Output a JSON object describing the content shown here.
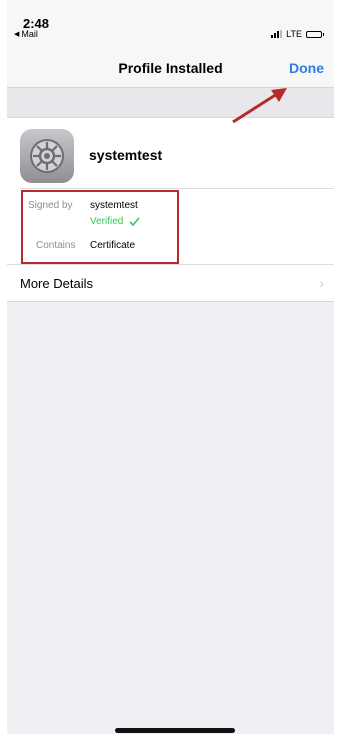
{
  "status_bar": {
    "time": "2:48",
    "back_app": "Mail",
    "network": "LTE"
  },
  "nav": {
    "title": "Profile Installed",
    "done_label": "Done"
  },
  "profile": {
    "name": "systemtest",
    "icon": "settings-gear-icon"
  },
  "details": {
    "signed_by_label": "Signed by",
    "signed_by_value": "systemtest",
    "verified_label": "Verified",
    "contains_label": "Contains",
    "contains_value": "Certificate"
  },
  "more_details": {
    "label": "More Details"
  },
  "colors": {
    "accent": "#2d7de9",
    "verified": "#34c759",
    "annotation": "#b52b2b"
  }
}
